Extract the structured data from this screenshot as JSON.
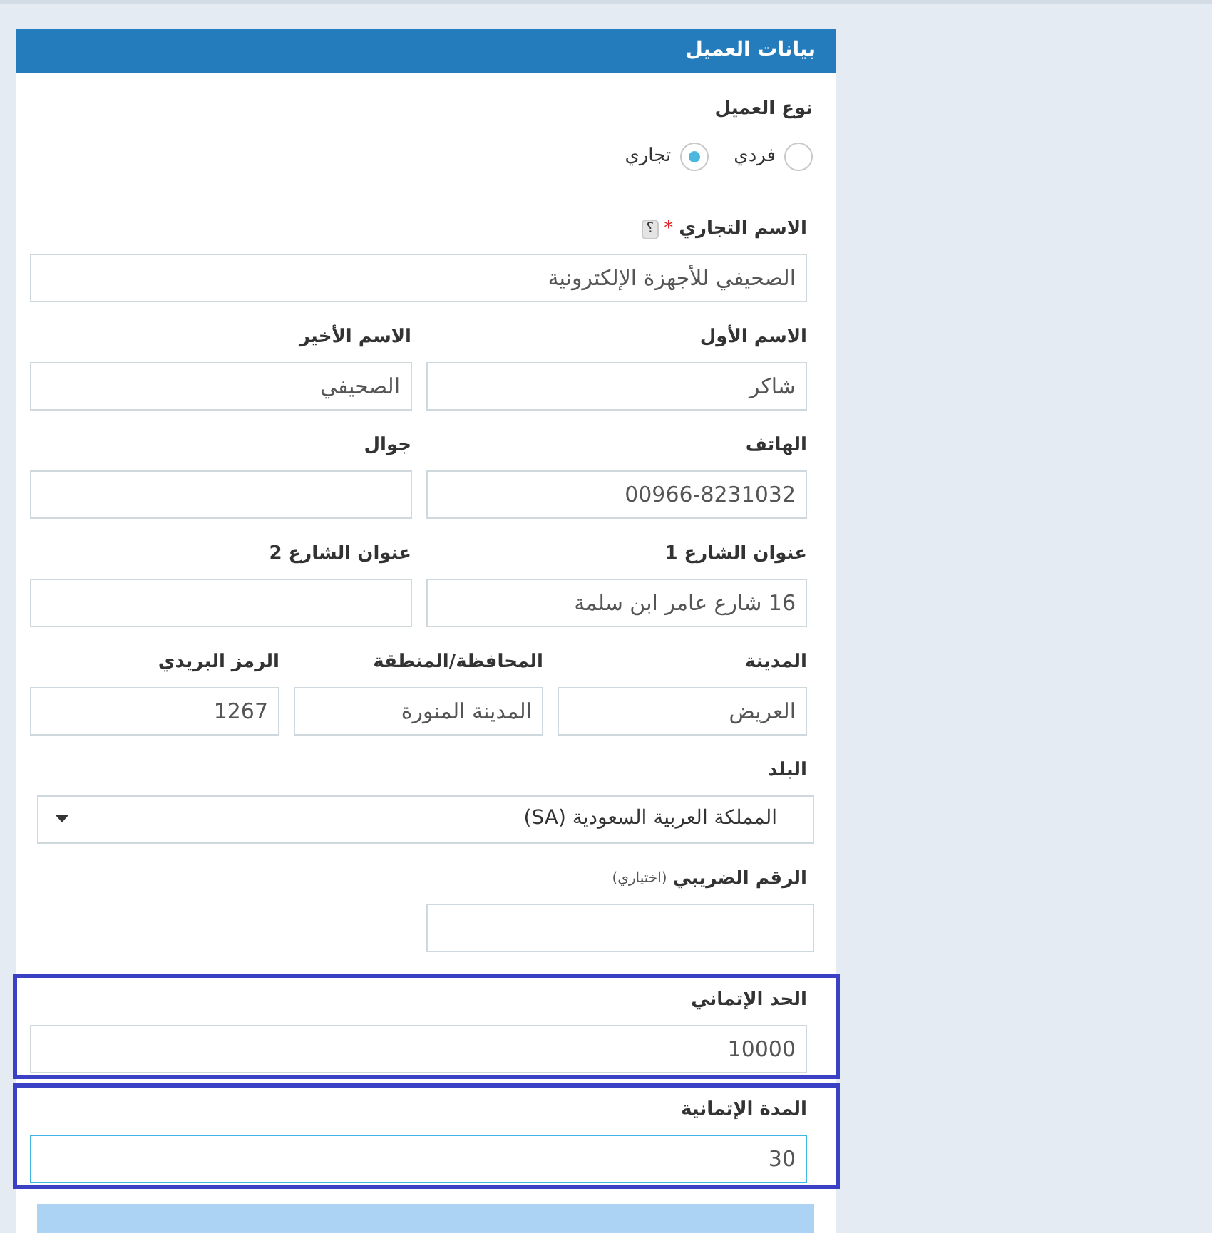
{
  "panel": {
    "title": "بيانات العميل"
  },
  "customer_type": {
    "label": "نوع العميل",
    "options": [
      {
        "label": "فردي",
        "selected": false
      },
      {
        "label": "تجاري",
        "selected": true
      }
    ]
  },
  "rows": [
    {
      "kind": "text",
      "highlighted": false,
      "fields": [
        {
          "label": "الاسم التجاري",
          "required_mark": "*",
          "help": "؟",
          "value": "الصحيفي للأجهزة الإلكترونية",
          "focused": false
        }
      ]
    },
    {
      "kind": "text",
      "highlighted": false,
      "fields": [
        {
          "label": "الاسم الأول",
          "value": "شاكر",
          "focused": false
        },
        {
          "label": "الاسم الأخير",
          "value": "الصحيفي",
          "focused": false
        }
      ]
    },
    {
      "kind": "text",
      "highlighted": false,
      "fields": [
        {
          "label": "الهاتف",
          "value": "00966-8231032",
          "focused": false
        },
        {
          "label": "جوال",
          "focused": false
        }
      ]
    },
    {
      "kind": "text",
      "highlighted": false,
      "fields": [
        {
          "label": "عنوان الشارع 1",
          "value": "16 شارع عامر ابن سلمة",
          "focused": false
        },
        {
          "label": "عنوان الشارع 2",
          "focused": false
        }
      ]
    },
    {
      "kind": "text",
      "highlighted": false,
      "fields": [
        {
          "label": "المدينة",
          "value": "العريض",
          "focused": false
        },
        {
          "label": "المحافظة/المنطقة",
          "value": "المدينة المنورة",
          "focused": false
        },
        {
          "label": "الرمز البريدي",
          "value": "1267",
          "focused": false
        }
      ]
    },
    {
      "kind": "select",
      "highlighted": false,
      "fields": [
        {
          "label": "البلد",
          "value": "المملكة العربية السعودية (SA)"
        }
      ]
    },
    {
      "kind": "half",
      "highlighted": false,
      "fields": [
        {
          "label": "الرقم الضريبي",
          "note": "(اختياري)",
          "focused": false
        }
      ]
    },
    {
      "kind": "text",
      "highlighted": true,
      "fields": [
        {
          "label": "الحد الإتماني",
          "value": "10000",
          "focused": false
        }
      ]
    },
    {
      "kind": "text",
      "highlighted": true,
      "fields": [
        {
          "label": "المدة الإتمانية",
          "value": "30",
          "focused": true
        }
      ]
    }
  ]
}
